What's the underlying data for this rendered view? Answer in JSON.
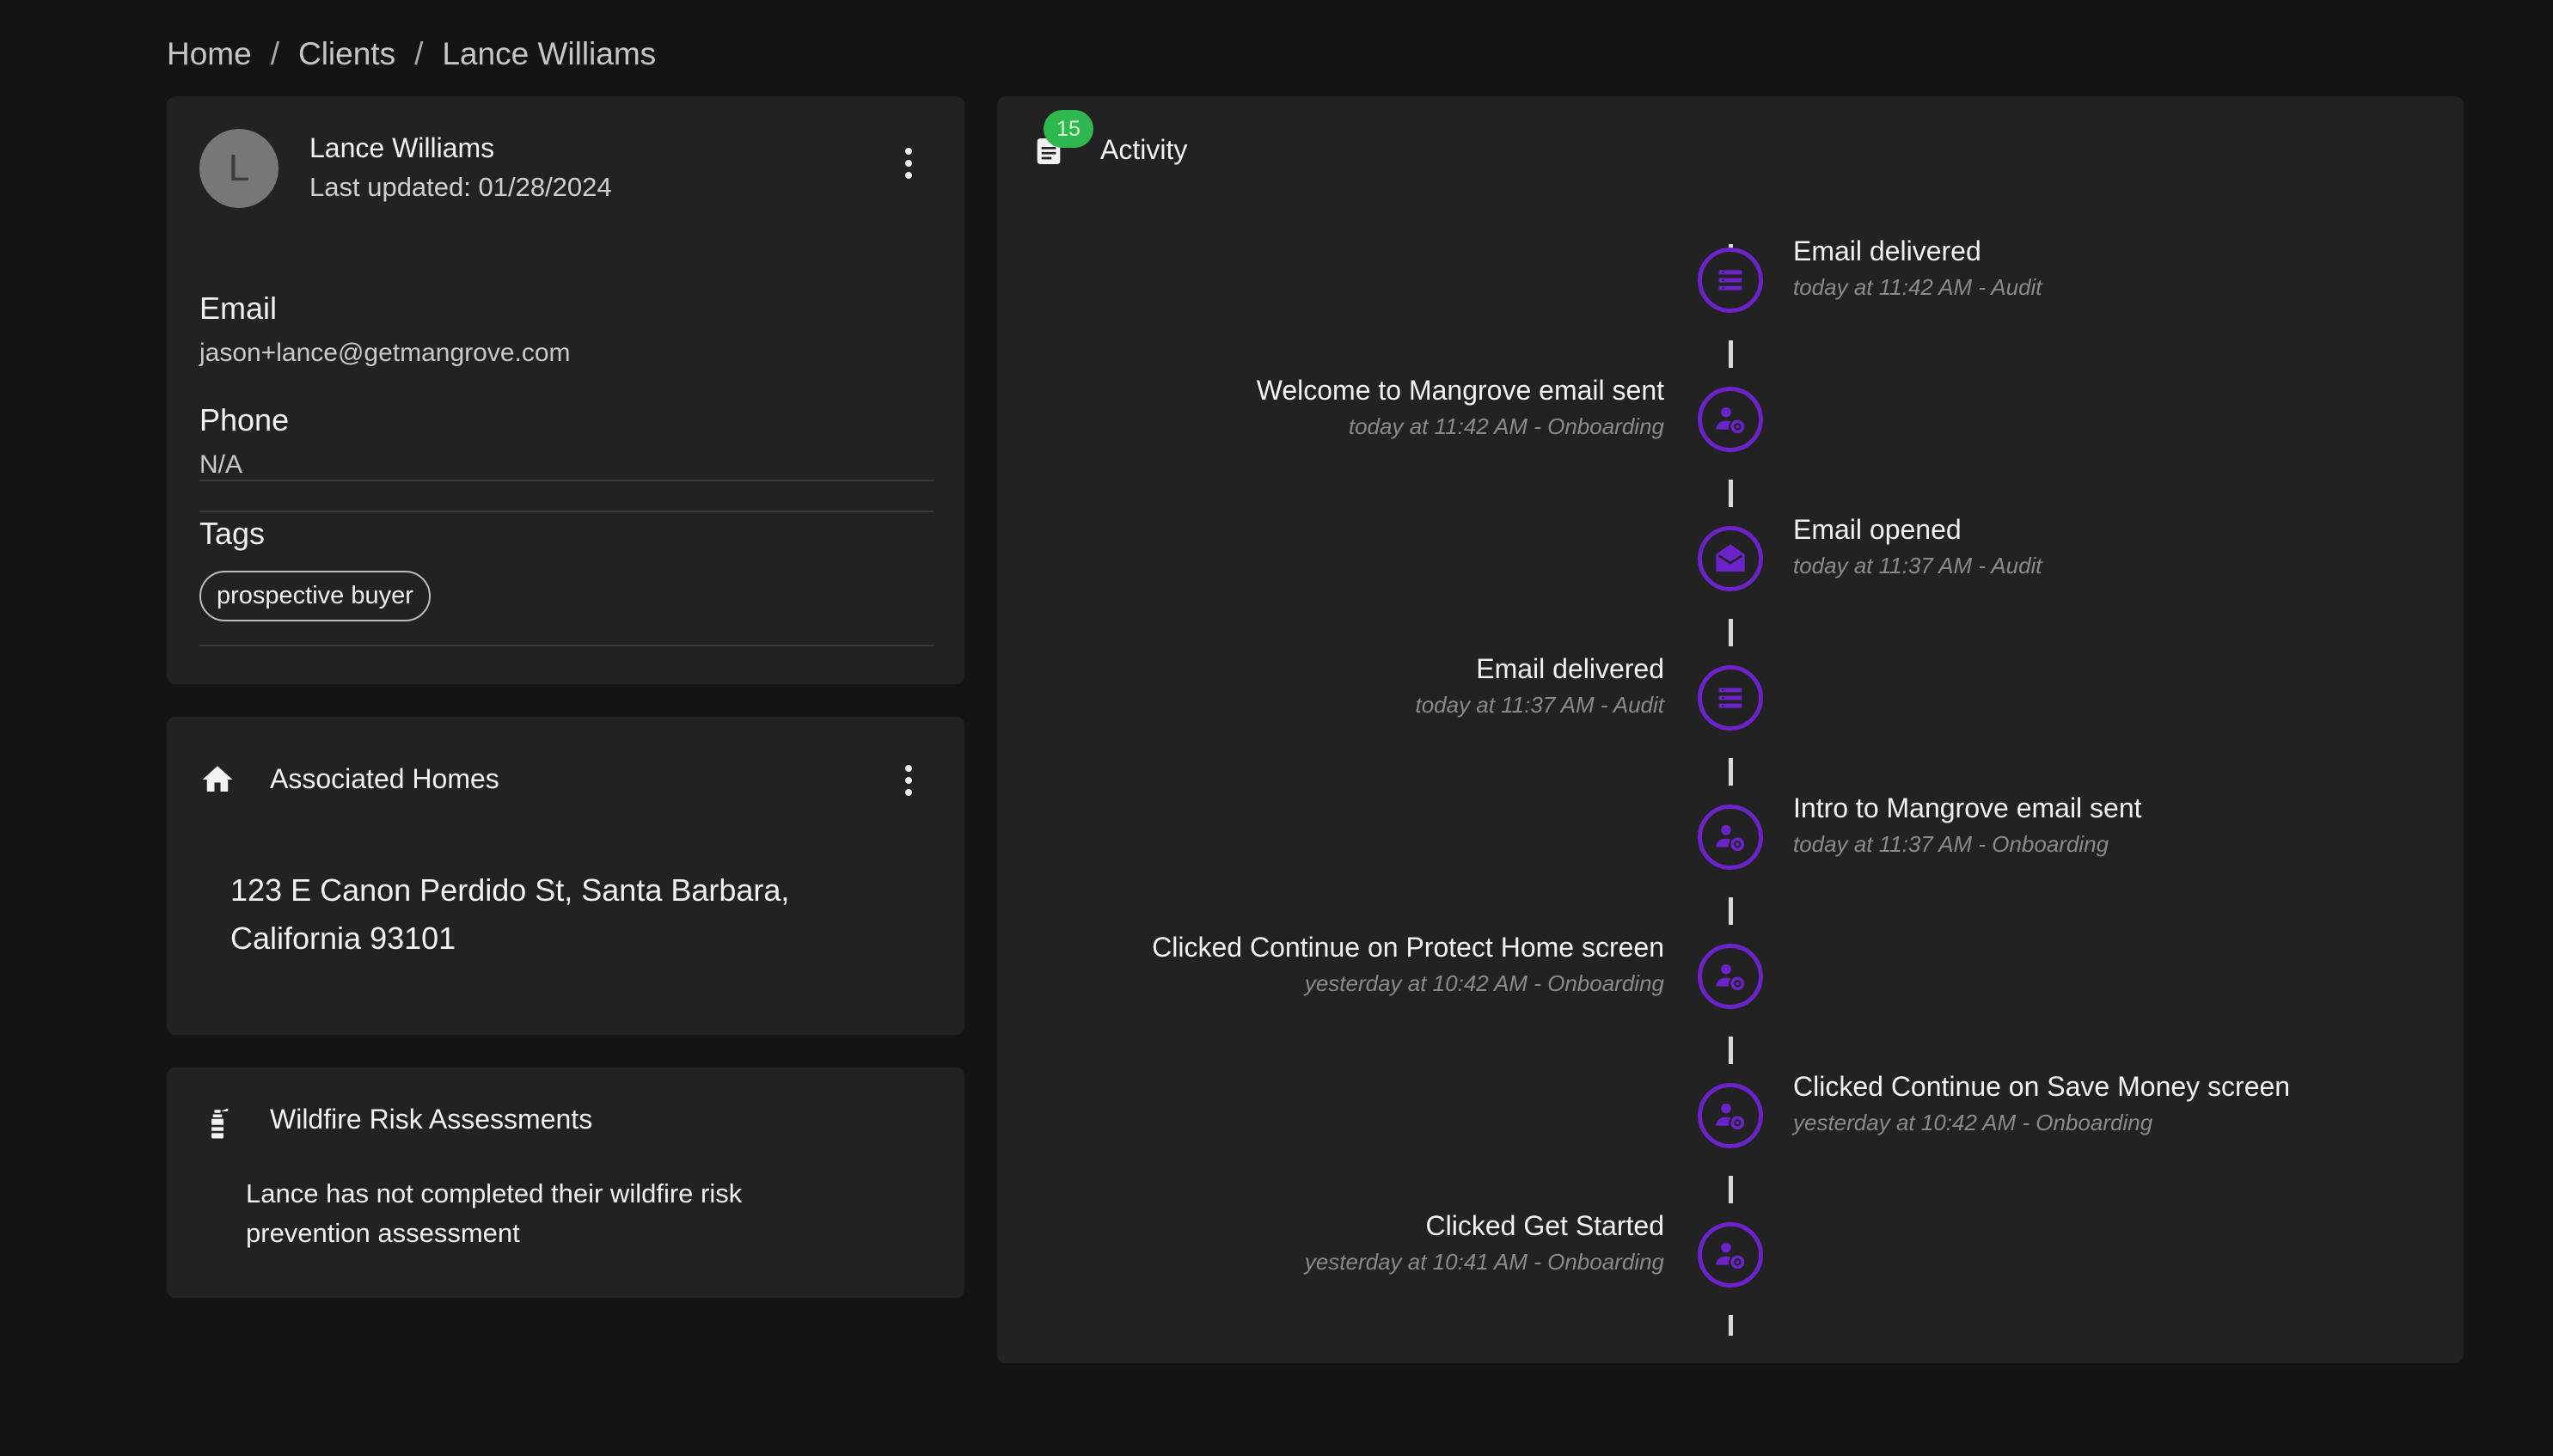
{
  "breadcrumb": {
    "home": "Home",
    "sep1": "/",
    "clients": "Clients",
    "sep2": "/",
    "current": "Lance Williams"
  },
  "client": {
    "avatar_initial": "L",
    "name": "Lance Williams",
    "last_updated": "Last updated: 01/28/2024",
    "email_label": "Email",
    "email_value": "jason+lance@getmangrove.com",
    "phone_label": "Phone",
    "phone_value": "N/A",
    "tags_label": "Tags",
    "tags": [
      "prospective buyer"
    ]
  },
  "homes": {
    "title": "Associated Homes",
    "address": "123 E Canon Perdido St, Santa Barbara, California 93101"
  },
  "wildfire": {
    "title": "Wildfire Risk Assessments",
    "message": "Lance has not completed their wildfire risk prevention assessment"
  },
  "activity": {
    "title": "Activity",
    "count": "15",
    "accent_color": "#6b23c9",
    "badge_color": "#2fb84f",
    "events": [
      {
        "title": "Email delivered",
        "meta": "today at 11:42 AM - Audit",
        "icon": "list-icon",
        "side": "right"
      },
      {
        "title": "Welcome to Mangrove email sent",
        "meta": "today at 11:42 AM - Onboarding",
        "icon": "user-gear-icon",
        "side": "left"
      },
      {
        "title": "Email opened",
        "meta": "today at 11:37 AM - Audit",
        "icon": "envelope-open-icon",
        "side": "right"
      },
      {
        "title": "Email delivered",
        "meta": "today at 11:37 AM - Audit",
        "icon": "list-icon",
        "side": "left"
      },
      {
        "title": "Intro to Mangrove email sent",
        "meta": "today at 11:37 AM - Onboarding",
        "icon": "user-gear-icon",
        "side": "right"
      },
      {
        "title": "Clicked Continue on Protect Home screen",
        "meta": "yesterday at 10:42 AM - Onboarding",
        "icon": "user-gear-icon",
        "side": "left"
      },
      {
        "title": "Clicked Continue on Save Money screen",
        "meta": "yesterday at 10:42 AM - Onboarding",
        "icon": "user-gear-icon",
        "side": "right"
      },
      {
        "title": "Clicked Get Started",
        "meta": "yesterday at 10:41 AM - Onboarding",
        "icon": "user-gear-icon",
        "side": "left"
      }
    ]
  }
}
